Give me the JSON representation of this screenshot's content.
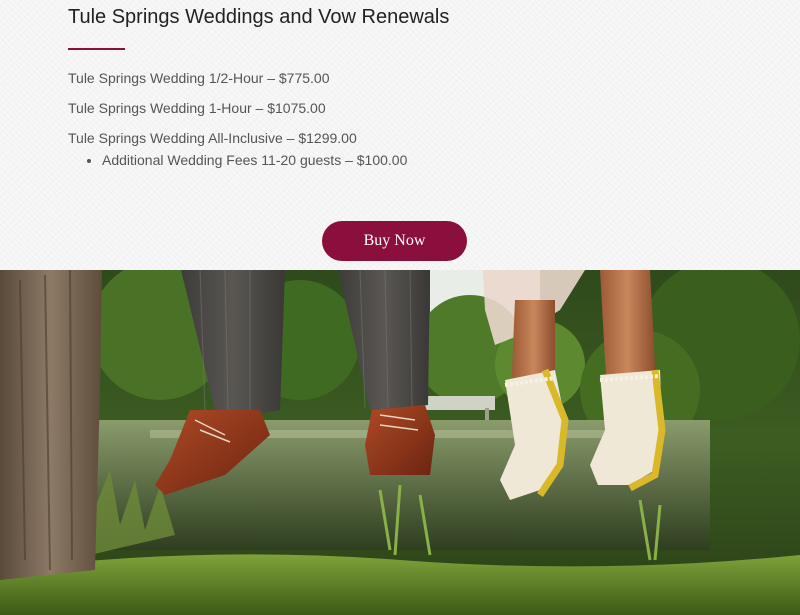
{
  "page": {
    "title": "Tule Springs Weddings and Vow Renewals"
  },
  "prices": [
    {
      "label": "Tule Springs Wedding 1/2-Hour – $775.00"
    },
    {
      "label": "Tule Springs Wedding 1-Hour – $1075.00"
    },
    {
      "label": "Tule Springs Wedding All-Inclusive – $1299.00"
    }
  ],
  "fees": [
    {
      "label": "Additional Wedding Fees 11-20 guests – $100.00"
    }
  ],
  "cta": {
    "buy_label": "Buy Now"
  },
  "colors": {
    "accent": "#8b0f3c"
  }
}
